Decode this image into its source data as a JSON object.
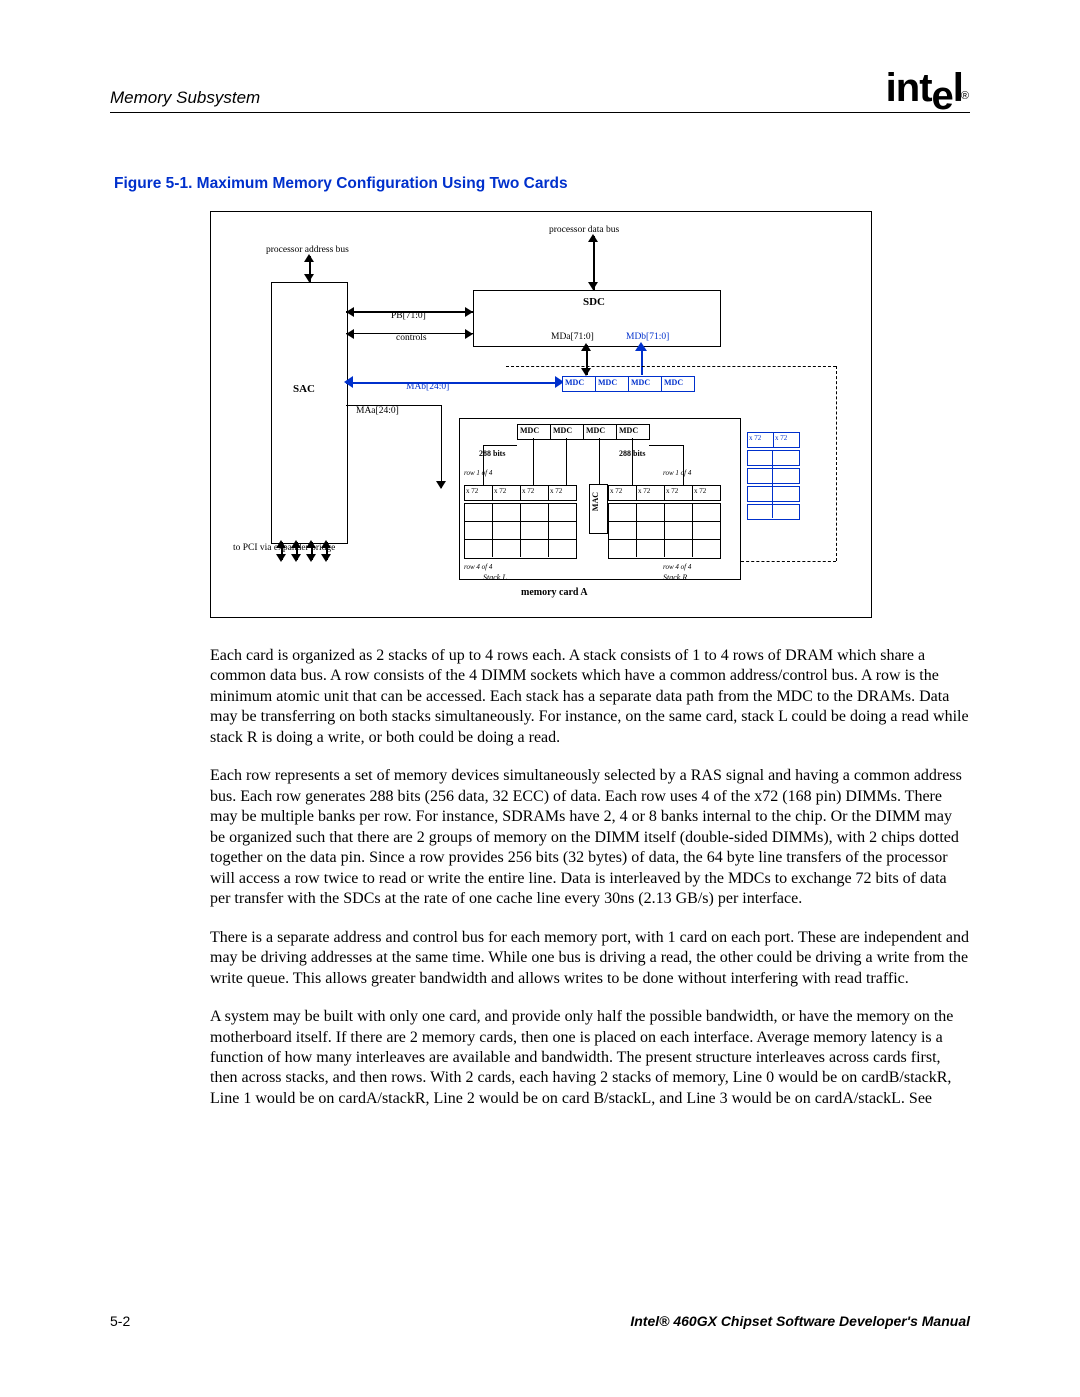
{
  "header": {
    "section_title": "Memory Subsystem",
    "logo_text_1": "int",
    "logo_text_2": "e",
    "logo_text_3": "l",
    "logo_reg": "®"
  },
  "figure": {
    "caption": "Figure 5-1. Maximum Memory Configuration Using Two Cards",
    "labels": {
      "proc_addr_bus": "processor address bus",
      "proc_data_bus": "processor data bus",
      "sac": "SAC",
      "sdc": "SDC",
      "pb": "PB[71:0]",
      "controls": "controls",
      "mda": "MDa[71:0]",
      "mdb": "MDb[71:0]",
      "mab": "MAb[24:0]",
      "maa": "MAa[24:0]",
      "mdc": "MDC",
      "mac": "MAC",
      "to_pci": "to PCI via expander bridge",
      "bits288_l": "288 bits",
      "bits288_r": "288 bits",
      "x72": "x 72",
      "row1": "row 1 of 4",
      "row4": "row 4 of 4",
      "stackL": "Stack L",
      "stackR": "Stack R",
      "mem_card": "memory card A"
    }
  },
  "paragraphs": {
    "p1": "Each card is organized as 2 stacks of up to 4 rows each. A stack consists of 1 to 4 rows of DRAM which share a common data bus. A row consists of the 4 DIMM sockets which have a common address/control bus. A row is the minimum atomic unit that can be accessed. Each stack has a separate data path from the MDC to the DRAMs. Data may be transferring on both stacks simultaneously.   For instance, on the same card, stack L could be doing a read while stack R is doing a write, or both could be doing a read.",
    "p2": "Each row represents a set of memory devices simultaneously selected by a RAS signal and having a common address bus. Each row generates 288 bits (256 data, 32 ECC) of data. Each row uses 4 of the x72 (168 pin) DIMMs. There may be multiple banks per row. For instance, SDRAMs have 2, 4 or 8 banks internal to the chip. Or the DIMM may be organized such that there are 2 groups of memory on the DIMM itself (double-sided DIMMs), with 2 chips dotted together on the data pin. Since a row provides 256 bits (32 bytes) of data, the 64 byte line transfers of the processor will access a row twice to read or write the entire line. Data is interleaved by the MDCs to exchange 72 bits of data per transfer with the SDCs at the rate of one cache line every 30ns (2.13 GB/s) per interface.",
    "p3": "There is a separate address and control bus for each memory port, with 1 card on each port. These are independent and may be driving addresses at the same time. While one bus is driving a read, the other could be driving a write from the write queue. This allows greater bandwidth and allows writes to be done without interfering with read traffic.",
    "p4": "A system may be built with only one card, and provide only half the possible bandwidth, or have the memory on the motherboard itself. If there are 2 memory cards, then one is placed on each interface. Average memory latency is a function of how many interleaves are available and bandwidth. The present structure interleaves across cards first, then across stacks, and then rows. With 2 cards, each having 2 stacks of memory, Line 0 would be on cardB/stackR, Line 1 would be on cardA/stackR, Line 2 would be on card B/stackL, and Line 3 would be on cardA/stackL. See"
  },
  "footer": {
    "page_num": "5-2",
    "manual_title": "Intel® 460GX Chipset Software Developer's Manual"
  }
}
